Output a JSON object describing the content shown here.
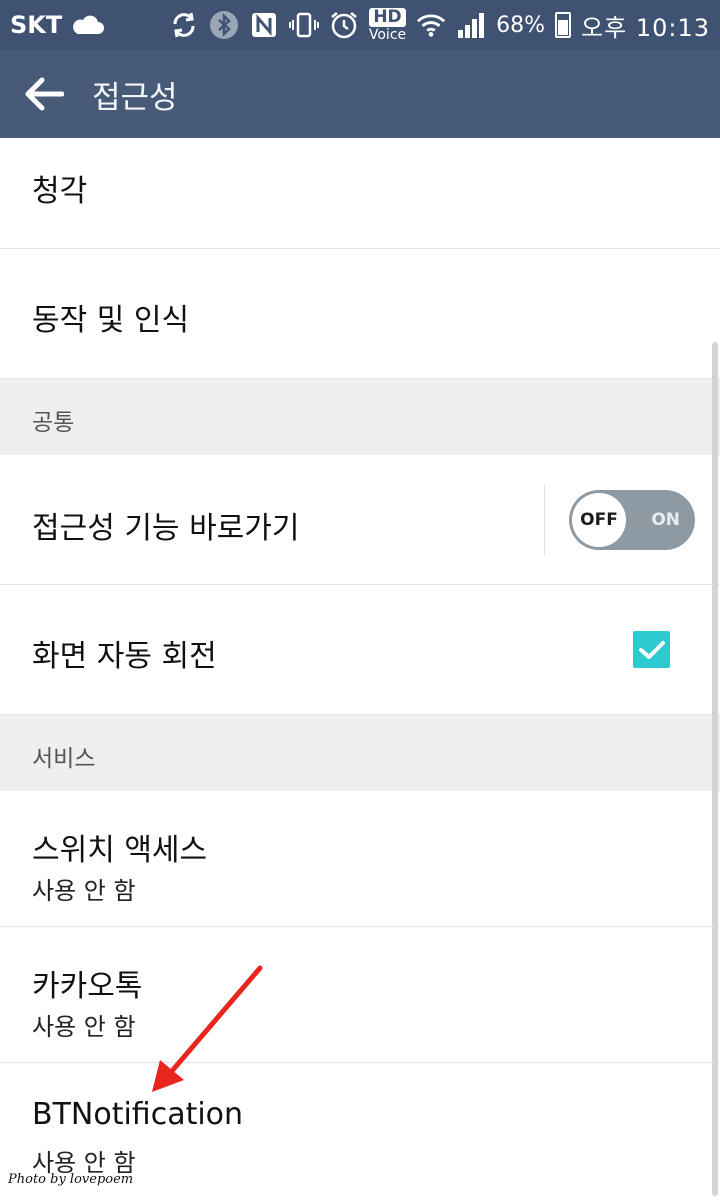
{
  "status_bar": {
    "carrier": "SKT",
    "hd_top": "HD",
    "hd_bottom": "Voice",
    "battery_percent": "68%",
    "battery_level": 0.68,
    "time": "오후 10:13",
    "icons": [
      "cloud-icon",
      "sync-icon",
      "bluetooth-icon",
      "nfc-icon",
      "vibrate-icon",
      "alarm-icon",
      "hd-voice-icon",
      "wifi-icon",
      "signal-icon",
      "battery-icon"
    ]
  },
  "app_bar": {
    "title": "접근성",
    "back_icon": "arrow-back-icon"
  },
  "list": {
    "item_hearing": "청각",
    "item_motion": "동작 및 인식",
    "section_common": "공통",
    "item_shortcut": "접근성 기능 바로가기",
    "toggle_off": "OFF",
    "toggle_on": "ON",
    "item_rotate": "화면 자동 회전",
    "section_services": "서비스",
    "item_switch": "스위치 액세스",
    "item_switch_status": "사용 안 함",
    "item_kakao": "카카오톡",
    "item_kakao_status": "사용 안 함",
    "item_bt": "BTNotification",
    "item_bt_status": "사용 안 함"
  },
  "watermark": "Photo by lovepoem",
  "colors": {
    "status_bar": "#3f5272",
    "app_bar": "#475b79",
    "section_bg": "#efefef",
    "checkbox": "#2cc9cf",
    "toggle_track": "#8e9aa3",
    "annotation_arrow": "#e8251f"
  }
}
